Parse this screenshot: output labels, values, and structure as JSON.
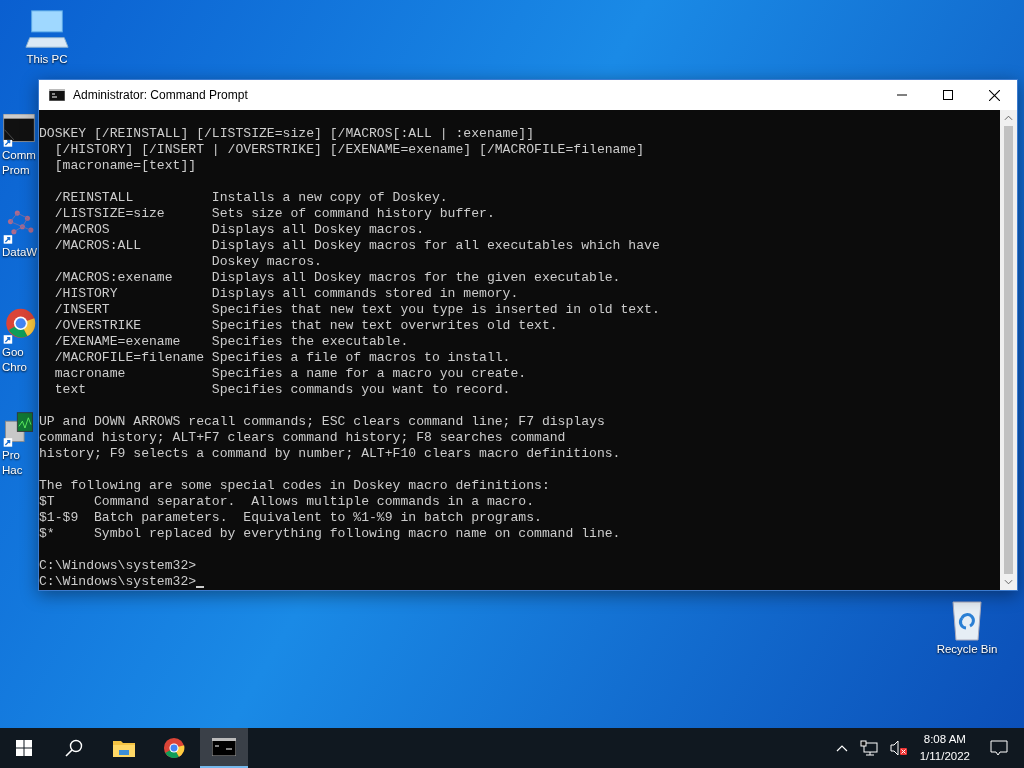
{
  "desktop_icons": [
    {
      "kind": "computer",
      "label_lines": [
        "This PC"
      ]
    },
    {
      "kind": "console",
      "label_lines": [
        "Comm",
        "Prom"
      ]
    },
    {
      "kind": "molecule",
      "label_lines": [
        "DataW"
      ]
    },
    {
      "kind": "browser",
      "label_lines": [
        "Goo",
        "Chro"
      ]
    },
    {
      "kind": "monitor",
      "label_lines": [
        "Pro",
        "Hac"
      ]
    },
    {
      "kind": "recycle",
      "label_lines": [
        "Recycle Bin"
      ]
    }
  ],
  "window": {
    "title": "Administrator: Command Prompt",
    "console_blocks": [
      [
        "DOSKEY [/REINSTALL] [/LISTSIZE=size] [/MACROS[:ALL | :exename]]",
        "  [/HISTORY] [/INSERT | /OVERSTRIKE] [/EXENAME=exename] [/MACROFILE=filename]",
        "  [macroname=[text]]"
      ],
      [
        "  /REINSTALL          Installs a new copy of Doskey.",
        "  /LISTSIZE=size      Sets size of command history buffer.",
        "  /MACROS             Displays all Doskey macros.",
        "  /MACROS:ALL         Displays all Doskey macros for all executables which have",
        "                      Doskey macros.",
        "  /MACROS:exename     Displays all Doskey macros for the given executable.",
        "  /HISTORY            Displays all commands stored in memory.",
        "  /INSERT             Specifies that new text you type is inserted in old text.",
        "  /OVERSTRIKE         Specifies that new text overwrites old text.",
        "  /EXENAME=exename    Specifies the executable.",
        "  /MACROFILE=filename Specifies a file of macros to install.",
        "  macroname           Specifies a name for a macro you create.",
        "  text                Specifies commands you want to record."
      ],
      [
        "UP and DOWN ARROWS recall commands; ESC clears command line; F7 displays",
        "command history; ALT+F7 clears command history; F8 searches command",
        "history; F9 selects a command by number; ALT+F10 clears macro definitions."
      ],
      [
        "The following are some special codes in Doskey macro definitions:",
        "$T     Command separator.  Allows multiple commands in a macro.",
        "$1-$9  Batch parameters.  Equivalent to %1-%9 in batch programs.",
        "$*     Symbol replaced by everything following macro name on command line."
      ],
      [
        "C:\\Windows\\system32>",
        "C:\\Windows\\system32>"
      ]
    ]
  },
  "taskbar": {
    "items": [
      {
        "kind": "start",
        "selected": false
      },
      {
        "kind": "search",
        "selected": false
      },
      {
        "kind": "folder",
        "selected": false
      },
      {
        "kind": "browser",
        "selected": false
      },
      {
        "kind": "console",
        "selected": true
      }
    ],
    "tray": {
      "volume_muted": true,
      "time": "8:08 AM",
      "date": "1/11/2022"
    }
  }
}
